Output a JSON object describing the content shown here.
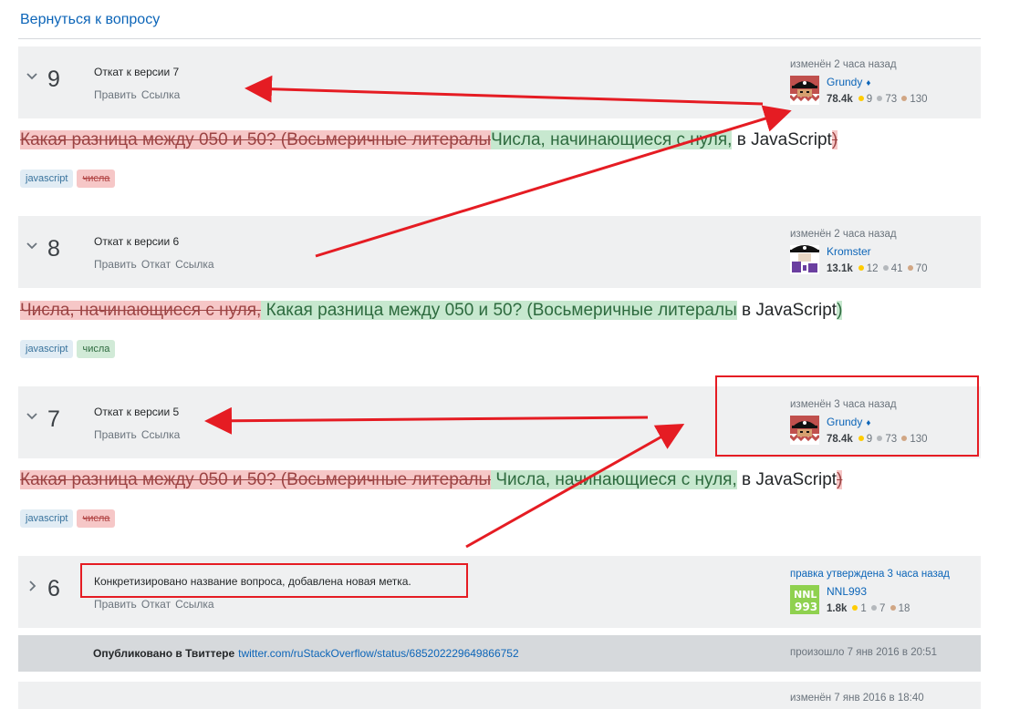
{
  "back_link": "Вернуться к вопросу",
  "revisions": [
    {
      "number": "9",
      "title": "Откат к версии 7",
      "actions": [
        "Править",
        "Ссылка"
      ],
      "when": "изменён 2 часа назад",
      "user": "Grundy",
      "moderator": "♦",
      "rep": "78.4k",
      "badges": {
        "gold": "9",
        "silver": "73",
        "bronze": "130"
      },
      "title_diff": {
        "deleted": "Какая разница между 050 и 50? (Восьмеричные литералы",
        "inserted": "Числа, начинающиеся с нуля,",
        "plain": " в JavaScript",
        "trail": ")"
      },
      "tags": [
        {
          "text": "javascript",
          "state": "normal"
        },
        {
          "text": "числа",
          "state": "deleted"
        }
      ]
    },
    {
      "number": "8",
      "title": "Откат к версии 6",
      "actions": [
        "Править",
        "Откат",
        "Ссылка"
      ],
      "when": "изменён 2 часа назад",
      "user": "Kromster",
      "rep": "13.1k",
      "badges": {
        "gold": "12",
        "silver": "41",
        "bronze": "70"
      },
      "title_diff": {
        "deleted": "Числа, начинающиеся с нуля,",
        "inserted": " Какая разница между 050 и 50? (Восьмеричные литералы",
        "plain": " в JavaScript",
        "trail": ")"
      },
      "tags": [
        {
          "text": "javascript",
          "state": "normal"
        },
        {
          "text": "числа",
          "state": "inserted"
        }
      ]
    },
    {
      "number": "7",
      "title": "Откат к версии 5",
      "actions": [
        "Править",
        "Ссылка"
      ],
      "when": "изменён 3 часа назад",
      "user": "Grundy",
      "moderator": "♦",
      "rep": "78.4k",
      "badges": {
        "gold": "9",
        "silver": "73",
        "bronze": "130"
      },
      "title_diff": {
        "deleted": "Какая разница между 050 и 50? (Восьмеричные литералы",
        "inserted": " Числа, начинающиеся с нуля,",
        "plain": " в JavaScript",
        "trail": ")"
      },
      "tags": [
        {
          "text": "javascript",
          "state": "normal"
        },
        {
          "text": "числа",
          "state": "deleted"
        }
      ]
    },
    {
      "number": "6",
      "title": "Конкретизировано название вопроса, добавлена новая метка.",
      "actions": [
        "Править",
        "Откат",
        "Ссылка"
      ],
      "when": "правка утверждена 3 часа назад",
      "user": "NNL993",
      "rep": "1.8k",
      "badges": {
        "gold": "1",
        "silver": "7",
        "bronze": "18"
      }
    }
  ],
  "twitter": {
    "label": "Опубликовано в Твиттере",
    "link": "twitter.com/ruStackOverflow/status/685202229649866752",
    "when": "произошло 7 янв 2016 в 20:51"
  },
  "last_row": {
    "when": "изменён 7 янв 2016 в 18:40"
  },
  "colors": {
    "link": "#0c65b8",
    "deleted": "#f6c7c7",
    "inserted": "#c7e8cf",
    "annotation": "#e51c23"
  }
}
